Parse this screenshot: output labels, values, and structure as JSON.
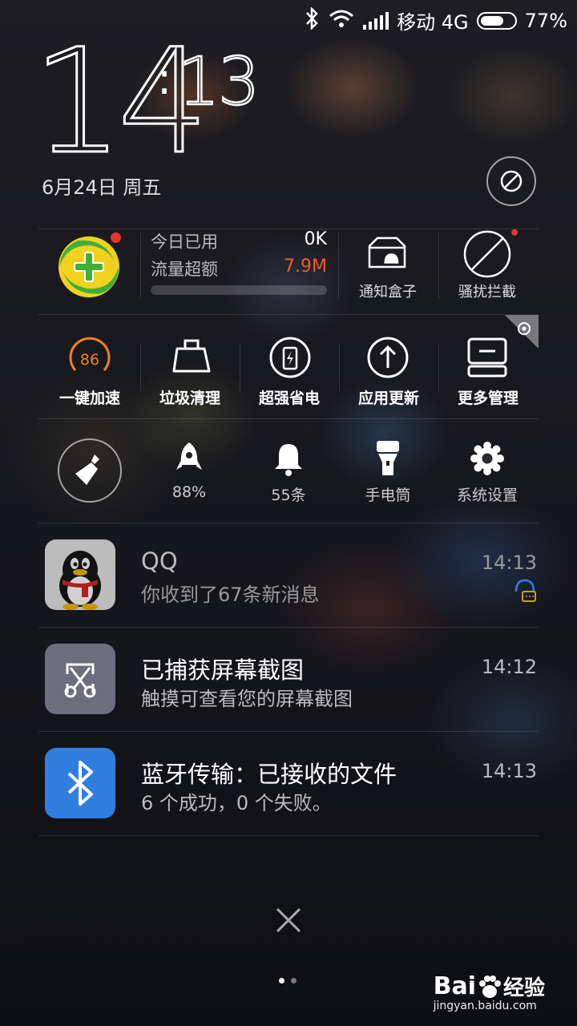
{
  "status_bar": {
    "carrier": "移动 4G",
    "battery_percent": "77%",
    "battery_level": 0.77
  },
  "clock": {
    "hour": "14",
    "colon": ":",
    "minute": "13"
  },
  "date": "6月24日 周五",
  "traffic": {
    "today_used_label": "今日已用",
    "today_used_value": "0K",
    "exceed_label": "流量超额",
    "exceed_value": "7.9M",
    "exceed_color": "#f05a28",
    "usage_level": 0
  },
  "widgets": [
    {
      "label": "通知盒子",
      "icon": "notification-box-icon"
    },
    {
      "label": "骚扰拦截",
      "icon": "block-icon"
    }
  ],
  "tools": [
    {
      "label": "一键加速",
      "icon": "speed-gauge-icon",
      "value": "86"
    },
    {
      "label": "垃圾清理",
      "icon": "trash-bag-icon"
    },
    {
      "label": "超强省电",
      "icon": "battery-saver-icon"
    },
    {
      "label": "应用更新",
      "icon": "update-arrow-icon"
    },
    {
      "label": "更多管理",
      "icon": "more-manage-icon"
    }
  ],
  "quick": [
    {
      "label": "88%",
      "icon": "rocket-icon"
    },
    {
      "label": "55条",
      "icon": "bell-icon"
    },
    {
      "label": "手电筒",
      "icon": "flashlight-icon"
    },
    {
      "label": "系统设置",
      "icon": "gear-icon"
    }
  ],
  "notifications": [
    {
      "app": "QQ",
      "title": "QQ",
      "subtitle": "你收到了67条新消息",
      "time": "14:13",
      "icon": "qq-penguin-icon"
    },
    {
      "app": "screenshot",
      "title": "已捕获屏幕截图",
      "subtitle": "触摸可查看您的屏幕截图",
      "time": "14:12",
      "icon": "scissors-icon"
    },
    {
      "app": "bluetooth",
      "title": "蓝牙传输：已接收的文件",
      "subtitle": "6 个成功，0 个失败。",
      "time": "14:13",
      "icon": "bluetooth-icon"
    }
  ],
  "watermark": {
    "brand": "Bai",
    "brand2": "经验",
    "url": "jingyan.baidu.com"
  },
  "accent": {
    "orange": "#f0821e",
    "red": "#e8322d",
    "blue": "#2f7fe0"
  }
}
